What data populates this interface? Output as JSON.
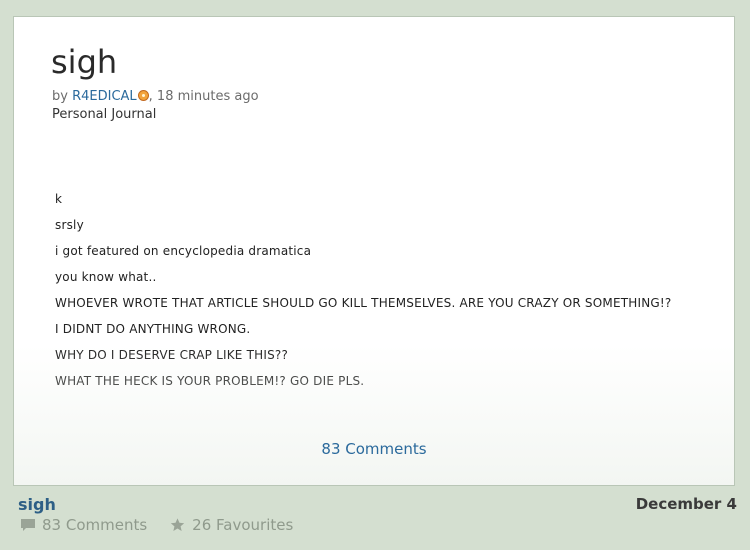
{
  "post": {
    "title": "sigh",
    "by_label": "by",
    "author": "R4EDICAL",
    "time_suffix": ", 18 minutes ago",
    "category": "Personal Journal",
    "lines": [
      "k",
      "srsly",
      "i got featured on encyclopedia dramatica",
      "you know what..",
      "WHOEVER WROTE THAT ARTICLE SHOULD GO KILL THEMSELVES. ARE YOU CRAZY OR SOMETHING!?",
      "I DIDNT DO ANYTHING WRONG.",
      "WHY DO I DESERVE CRAP LIKE THIS??",
      "WHAT THE HECK IS YOUR PROBLEM!? GO DIE PLS."
    ],
    "comments_link": "83 Comments"
  },
  "footer": {
    "title": "sigh",
    "date": "December 4",
    "comments": "83 Comments",
    "favourites": "26 Favourites"
  },
  "colors": {
    "background": "#d4dfd0",
    "link": "#2b6a9c",
    "badge": "#f2a33c"
  },
  "icons": {
    "author_badge": "deviant-badge-icon",
    "comments": "comment-bubble-icon",
    "favourites": "star-icon"
  }
}
